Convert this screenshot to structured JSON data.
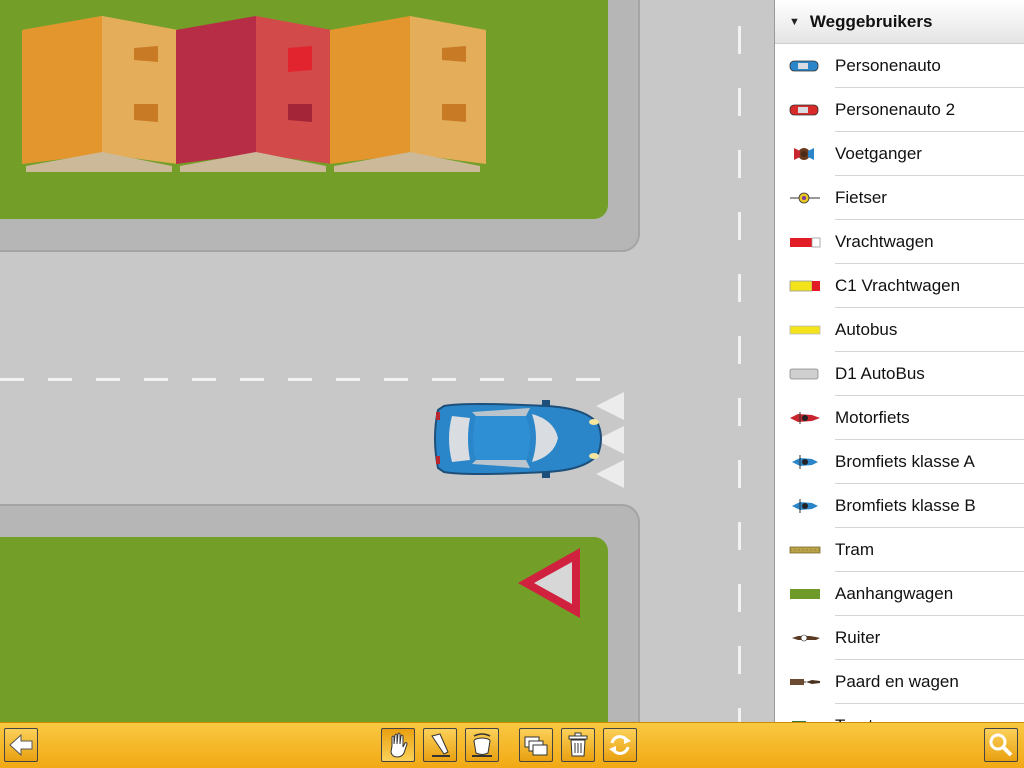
{
  "panel": {
    "title": "Weggebruikers",
    "items": [
      {
        "label": "Personenauto",
        "icon": "blue-car-icon",
        "color": "#2a86c9"
      },
      {
        "label": "Personenauto 2",
        "icon": "red-car-icon",
        "color": "#d92a2a"
      },
      {
        "label": "Voetganger",
        "icon": "pedestrian-icon",
        "color": "#c8262e"
      },
      {
        "label": "Fietser",
        "icon": "cyclist-icon",
        "color": "#e9c81f"
      },
      {
        "label": "Vrachtwagen",
        "icon": "truck-icon",
        "color": "#e21c24"
      },
      {
        "label": "C1 Vrachtwagen",
        "icon": "c1-truck-icon",
        "color": "#f2e31a"
      },
      {
        "label": "Autobus",
        "icon": "bus-icon",
        "color": "#f2e31a"
      },
      {
        "label": "D1 AutoBus",
        "icon": "d1-bus-icon",
        "color": "#cfcfcf"
      },
      {
        "label": "Motorfiets",
        "icon": "motorcycle-icon",
        "color": "#c8262e"
      },
      {
        "label": "Bromfiets klasse A",
        "icon": "moped-a-icon",
        "color": "#2a86c9"
      },
      {
        "label": "Bromfiets klasse B",
        "icon": "moped-b-icon",
        "color": "#2a86c9"
      },
      {
        "label": "Tram",
        "icon": "tram-icon",
        "color": "#b9a24a"
      },
      {
        "label": "Aanhangwagen",
        "icon": "trailer-icon",
        "color": "#6e9a2a"
      },
      {
        "label": "Ruiter",
        "icon": "horse-rider-icon",
        "color": "#5a3a22"
      },
      {
        "label": "Paard en wagen",
        "icon": "horse-cart-icon",
        "color": "#6a4a30"
      },
      {
        "label": "Tractor",
        "icon": "tractor-icon",
        "color": "#2f7a3a"
      }
    ]
  },
  "toolbar": {
    "buttons": [
      "back-arrow-icon",
      "hand-icon",
      "pen-icon",
      "bucket-icon",
      "layers-icon",
      "trash-icon",
      "rotate-icon",
      "search-icon"
    ]
  },
  "colors": {
    "grass": "#739f28",
    "road": "#d3d3d3",
    "toolbar": "#f4b324",
    "yield_sign": "#d0213f"
  }
}
